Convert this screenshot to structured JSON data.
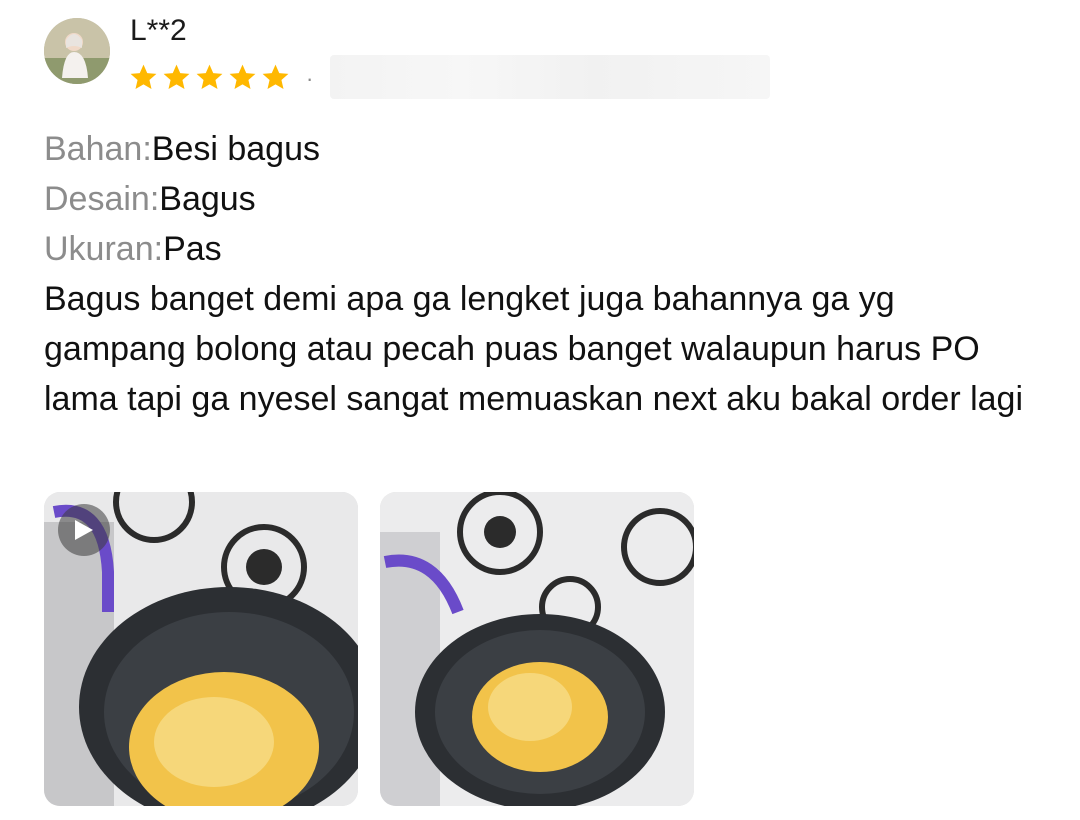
{
  "reviewer": {
    "name": "L**2",
    "avatar_icon": "profile-photo",
    "rating": 5,
    "rating_max": 5,
    "separator": "·"
  },
  "attributes": [
    {
      "label": "Bahan:",
      "value": "Besi bagus"
    },
    {
      "label": "Desain:",
      "value": "Bagus"
    },
    {
      "label": "Ukuran:",
      "value": "Pas"
    }
  ],
  "review_text": "Bagus banget demi apa ga lengket juga bahannya ga yg gampang bolong atau pecah puas banget walaupun harus PO lama tapi ga nyesel sangat memuaskan next aku bakal order lagi",
  "media": [
    {
      "type": "video",
      "icon": "play-icon"
    },
    {
      "type": "image"
    }
  ],
  "colors": {
    "star": "#FFB800",
    "label_gray": "#8C8C8C",
    "text": "#111111"
  }
}
